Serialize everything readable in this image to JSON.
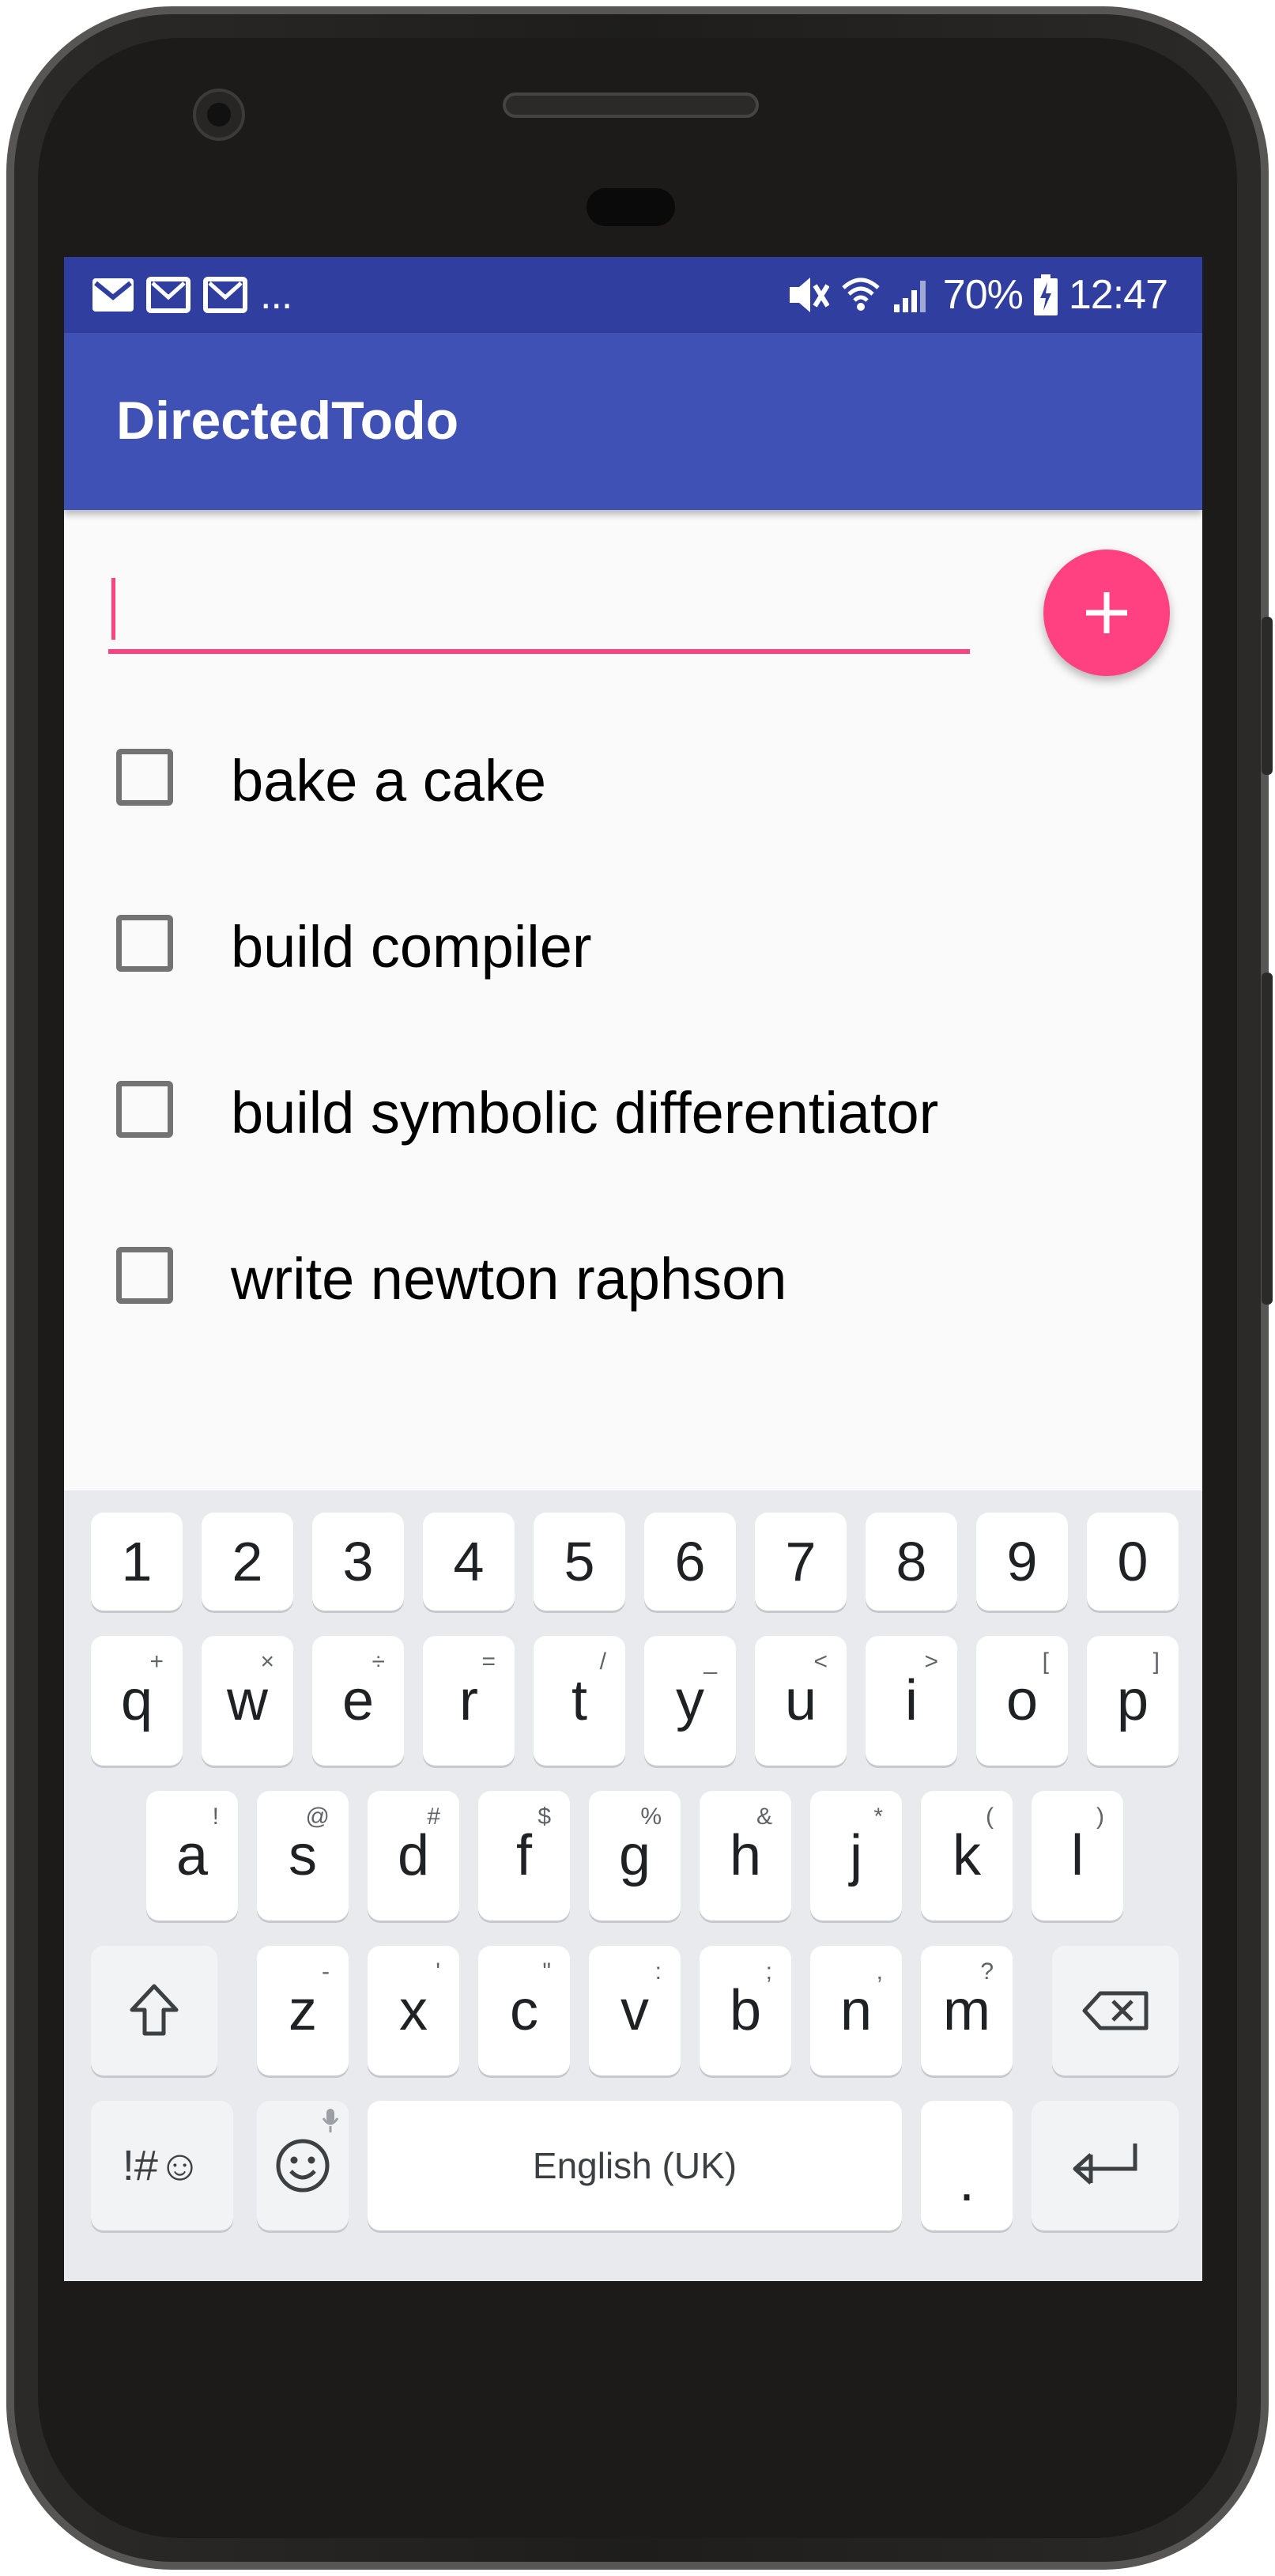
{
  "status_bar": {
    "overflow": "...",
    "battery_percent": "70%",
    "time": "12:47",
    "icons": [
      "gmail-icon",
      "gmail-icon",
      "gmail-icon",
      "vibrate-off-icon",
      "wifi-icon",
      "signal-icon",
      "battery-charging-icon"
    ]
  },
  "app_bar": {
    "title": "DirectedTodo"
  },
  "new_todo": {
    "value": "",
    "add_icon": "plus-icon",
    "accent": "#ff4081"
  },
  "todos": [
    {
      "label": "bake a cake",
      "checked": false
    },
    {
      "label": "build compiler",
      "checked": false
    },
    {
      "label": "build symbolic differentiator",
      "checked": false
    },
    {
      "label": "write newton raphson",
      "checked": false
    }
  ],
  "keyboard": {
    "number_row": [
      "1",
      "2",
      "3",
      "4",
      "5",
      "6",
      "7",
      "8",
      "9",
      "0"
    ],
    "row1": [
      {
        "k": "q",
        "h": "+"
      },
      {
        "k": "w",
        "h": "×"
      },
      {
        "k": "e",
        "h": "÷"
      },
      {
        "k": "r",
        "h": "="
      },
      {
        "k": "t",
        "h": "/"
      },
      {
        "k": "y",
        "h": "_"
      },
      {
        "k": "u",
        "h": "<"
      },
      {
        "k": "i",
        "h": ">"
      },
      {
        "k": "o",
        "h": "["
      },
      {
        "k": "p",
        "h": "]"
      }
    ],
    "row2": [
      {
        "k": "a",
        "h": "!"
      },
      {
        "k": "s",
        "h": "@"
      },
      {
        "k": "d",
        "h": "#"
      },
      {
        "k": "f",
        "h": "$"
      },
      {
        "k": "g",
        "h": "%"
      },
      {
        "k": "h",
        "h": "&"
      },
      {
        "k": "j",
        "h": "*"
      },
      {
        "k": "k",
        "h": "("
      },
      {
        "k": "l",
        "h": ")"
      }
    ],
    "row3": [
      {
        "k": "z",
        "h": "-"
      },
      {
        "k": "x",
        "h": "'"
      },
      {
        "k": "c",
        "h": "\""
      },
      {
        "k": "v",
        "h": ":"
      },
      {
        "k": "b",
        "h": ";"
      },
      {
        "k": "n",
        "h": ","
      },
      {
        "k": "m",
        "h": "?"
      }
    ],
    "symbols_label": "!#☺",
    "space_label": "English (UK)",
    "period_label": ".",
    "icons": [
      "shift-icon",
      "backspace-icon",
      "emoji-icon",
      "mic-icon",
      "enter-icon"
    ]
  },
  "colors": {
    "status_bar": "#303f9f",
    "app_bar": "#3f51b5",
    "accent": "#ff4081",
    "background": "#fafafa"
  }
}
